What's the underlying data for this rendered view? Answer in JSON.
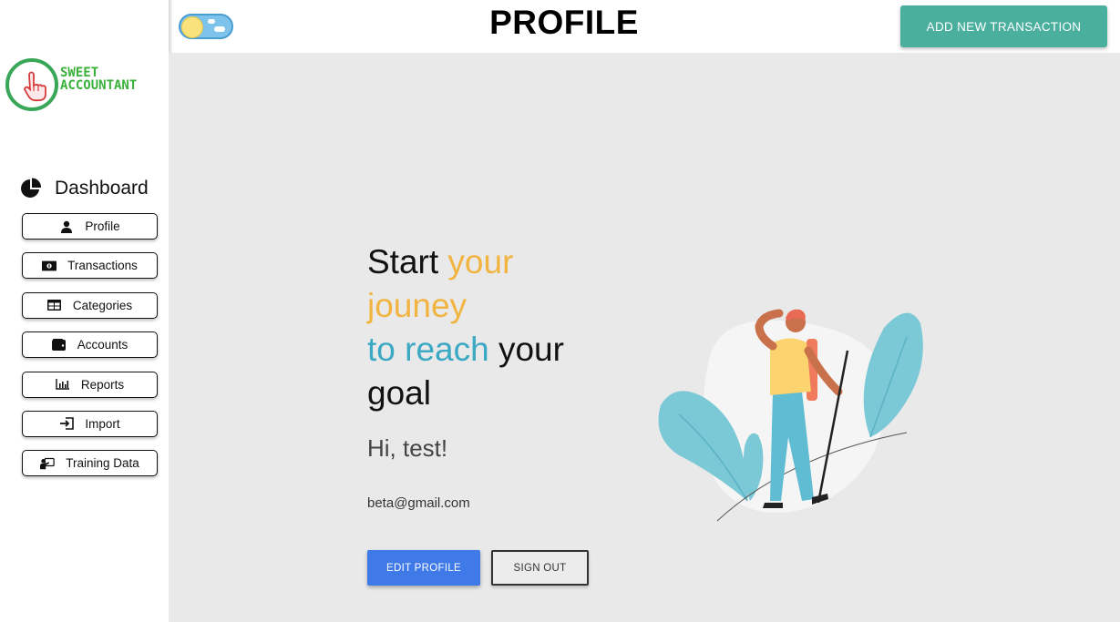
{
  "app": {
    "logo_line1": "SWEET",
    "logo_line2": "ACCOUNTANT"
  },
  "header": {
    "title": "PROFILE",
    "add_transaction_label": "ADD NEW TRANSACTION",
    "theme_toggle": "day"
  },
  "sidebar": {
    "dashboard_label": "Dashboard",
    "items": [
      {
        "label": "Profile",
        "icon": "user-icon"
      },
      {
        "label": "Transactions",
        "icon": "money-bill-icon"
      },
      {
        "label": "Categories",
        "icon": "table-icon"
      },
      {
        "label": "Accounts",
        "icon": "wallet-icon"
      },
      {
        "label": "Reports",
        "icon": "bar-chart-icon"
      },
      {
        "label": "Import",
        "icon": "import-icon"
      },
      {
        "label": "Training Data",
        "icon": "chalkboard-teacher-icon"
      }
    ]
  },
  "main": {
    "headline": {
      "part1": "Start ",
      "part2": "your",
      "part3": "jouney",
      "part4": "to reach",
      "part5": " your",
      "part6": "goal"
    },
    "greeting": "Hi, test!",
    "email": "beta@gmail.com",
    "edit_profile_label": "EDIT PROFILE",
    "sign_out_label": "SIGN OUT"
  },
  "colors": {
    "accent_green": "#4aaf9c",
    "accent_blue": "#3f7ae8",
    "headline_orange": "#f2b441",
    "headline_teal": "#3ba8c4",
    "logo_green": "#3ab13a"
  }
}
